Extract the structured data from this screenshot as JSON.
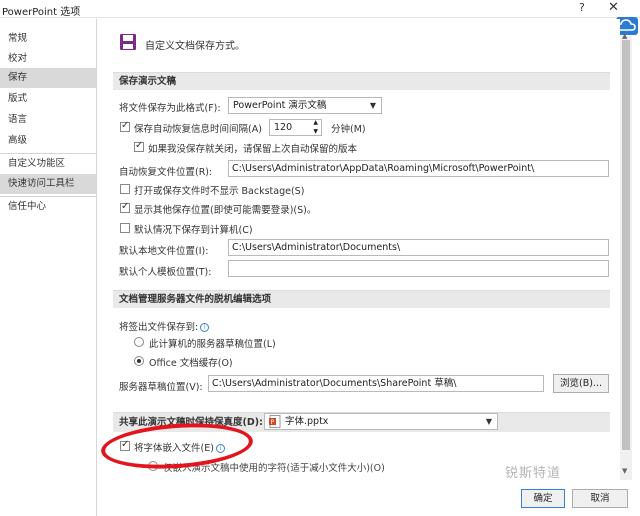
{
  "window": {
    "title": "PowerPoint 选项",
    "help": "?",
    "close": "✕"
  },
  "sidebar": {
    "items": [
      {
        "label": "常规"
      },
      {
        "label": "校对"
      },
      {
        "label": "保存"
      },
      {
        "label": "版式"
      },
      {
        "label": "语言"
      },
      {
        "label": "高级"
      },
      {
        "label": "自定义功能区"
      },
      {
        "label": "快速访问工具栏"
      },
      {
        "label": "信任中心"
      }
    ],
    "active_index": 2
  },
  "header": {
    "title": "自定义文档保存方式。"
  },
  "save_presentations": {
    "section_title": "保存演示文稿",
    "format_label": "将文件保存为此格式(F):",
    "format_value": "PowerPoint 演示文稿",
    "autorecover_label": "保存自动恢复信息时间间隔(A)",
    "autorecover_minutes": "120",
    "minutes_label": "分钟(M)",
    "keep_last_label": "如果我没保存就关闭，请保留上次自动保留的版本",
    "autorecover_location_label": "自动恢复文件位置(R):",
    "autorecover_location_value": "C:\\Users\\Administrator\\AppData\\Roaming\\Microsoft\\PowerPoint\\",
    "no_backstage_label": "打开或保存文件时不显示 Backstage(S)",
    "show_extra_label": "显示其他保存位置(即使可能需要登录)(S)。",
    "default_computer_label": "默认情况下保存到计算机(C)",
    "default_local_label": "默认本地文件位置(I):",
    "default_local_value": "C:\\Users\\Administrator\\Documents\\",
    "personal_templates_label": "默认个人模板位置(T):",
    "personal_templates_value": ""
  },
  "offline_editing": {
    "section_title": "文档管理服务器文件的脱机编辑选项",
    "save_checkout_label": "将签出文件保存到:",
    "server_drafts_label": "此计算机的服务器草稿位置(L)",
    "office_cache_label": "Office 文档缓存(O)",
    "server_drafts_location_label": "服务器草稿位置(V):",
    "server_drafts_location_value": "C:\\Users\\Administrator\\Documents\\SharePoint 草稿\\",
    "browse_label": "浏览(B)..."
  },
  "fidelity": {
    "section_label": "共享此演示文稿时保持保真度(D):",
    "file_value": "字体.pptx",
    "embed_fonts_label": "将字体嵌入文件(E)",
    "embed_only_used_label": "仅嵌入演示文稿中使用的字符(适于减小文件大小)(O)"
  },
  "footer": {
    "ok_label": "确定",
    "cancel_label": "取消"
  },
  "watermark": "锐斯特道",
  "colors": {
    "annotation": "#e3141e",
    "accent": "#3a7fd4",
    "save_icon": "#7b2c87"
  }
}
